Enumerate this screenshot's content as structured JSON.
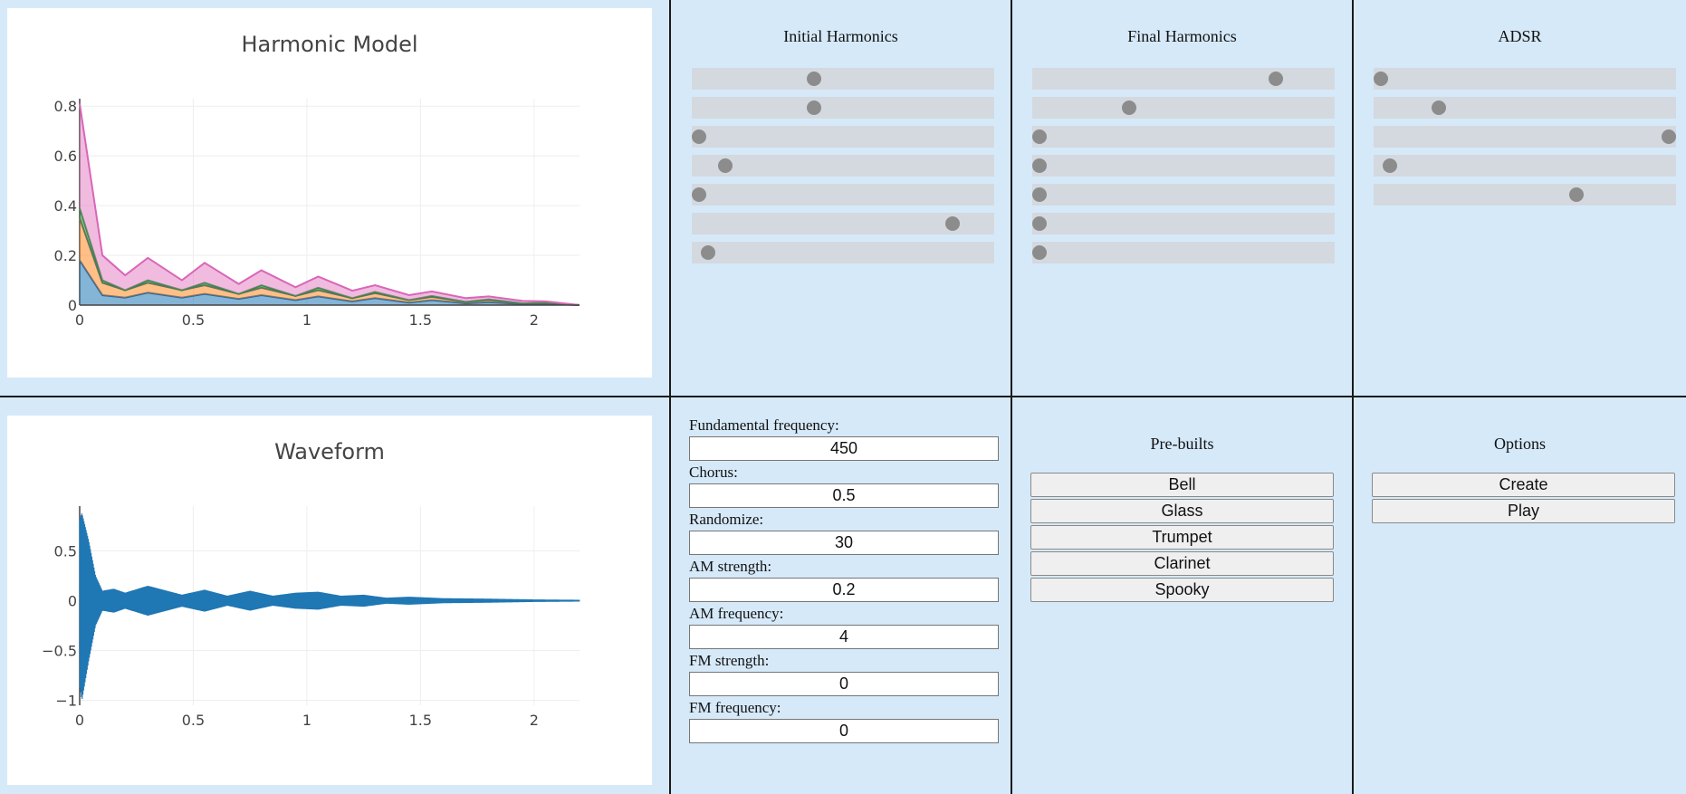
{
  "harmonic_plot": {
    "title": "Harmonic Model",
    "chart_data": {
      "type": "area",
      "x_range": [
        0,
        2.2
      ],
      "y_range": [
        0,
        0.83
      ],
      "x_ticks": [
        "0",
        "0.5",
        "1",
        "1.5",
        "2"
      ],
      "y_ticks": [
        "0",
        "0.2",
        "0.4",
        "0.6",
        "0.8"
      ],
      "x": [
        0,
        0.1,
        0.2,
        0.3,
        0.45,
        0.55,
        0.7,
        0.8,
        0.95,
        1.05,
        1.2,
        1.3,
        1.45,
        1.55,
        1.7,
        1.8,
        1.95,
        2.05,
        2.2
      ],
      "series": [
        {
          "values": [
            0.18,
            0.04,
            0.03,
            0.05,
            0.03,
            0.045,
            0.025,
            0.04,
            0.02,
            0.035,
            0.015,
            0.028,
            0.01,
            0.02,
            0.007,
            0.012,
            0.004,
            0.005,
            0.0
          ]
        },
        {
          "values": [
            0.17,
            0.05,
            0.03,
            0.04,
            0.03,
            0.035,
            0.02,
            0.03,
            0.017,
            0.025,
            0.013,
            0.02,
            0.01,
            0.013,
            0.006,
            0.009,
            0.003,
            0.004,
            0.0
          ]
        },
        {
          "values": [
            0.04,
            0.01,
            0.0,
            0.01,
            0.0,
            0.01,
            0.0,
            0.01,
            0.0,
            0.01,
            0.0,
            0.005,
            0.0,
            0.004,
            0.0,
            0.002,
            0.0,
            0.001,
            0.0
          ]
        },
        {
          "values": [
            0.42,
            0.1,
            0.06,
            0.09,
            0.04,
            0.08,
            0.04,
            0.06,
            0.035,
            0.045,
            0.03,
            0.027,
            0.02,
            0.018,
            0.015,
            0.012,
            0.01,
            0.005,
            0.0
          ]
        }
      ]
    }
  },
  "waveform_plot": {
    "title": "Waveform",
    "chart_data": {
      "type": "line",
      "x_range": [
        0,
        2.2
      ],
      "y_range": [
        -1.05,
        0.95
      ],
      "x_ticks": [
        "0",
        "0.5",
        "1",
        "1.5",
        "2"
      ],
      "y_ticks": [
        "0.5",
        "0",
        "−0.5",
        "−1"
      ],
      "y_tick_values": [
        0.5,
        0,
        -0.5,
        -1
      ],
      "envelope_x": [
        0,
        0.01,
        0.04,
        0.07,
        0.1,
        0.15,
        0.2,
        0.3,
        0.35,
        0.45,
        0.55,
        0.65,
        0.75,
        0.85,
        0.95,
        1.05,
        1.15,
        1.25,
        1.35,
        1.45,
        1.6,
        1.8,
        2.0,
        2.2
      ],
      "envelope_top": [
        0.82,
        0.88,
        0.6,
        0.25,
        0.1,
        0.12,
        0.08,
        0.15,
        0.12,
        0.06,
        0.11,
        0.05,
        0.1,
        0.05,
        0.08,
        0.09,
        0.05,
        0.06,
        0.03,
        0.04,
        0.025,
        0.02,
        0.012,
        0.008
      ],
      "envelope_bottom": [
        -0.85,
        -1.0,
        -0.6,
        -0.25,
        -0.1,
        -0.12,
        -0.08,
        -0.15,
        -0.12,
        -0.06,
        -0.11,
        -0.05,
        -0.1,
        -0.05,
        -0.08,
        -0.09,
        -0.05,
        -0.06,
        -0.03,
        -0.04,
        -0.025,
        -0.02,
        -0.012,
        -0.008
      ]
    }
  },
  "initial_harmonics": {
    "title": "Initial Harmonics",
    "sliders": [
      0.4,
      0.4,
      0.0,
      0.09,
      0.0,
      0.88,
      0.03
    ]
  },
  "final_harmonics": {
    "title": "Final Harmonics",
    "sliders": [
      0.82,
      0.31,
      0.0,
      0.0,
      0.0,
      0.0,
      0.0
    ]
  },
  "adsr": {
    "title": "ADSR",
    "sliders": [
      0.0,
      0.2,
      1.0,
      0.03,
      0.68
    ]
  },
  "parameters": {
    "fields": [
      {
        "label": "Fundamental frequency:",
        "value": "450"
      },
      {
        "label": "Chorus:",
        "value": "0.5"
      },
      {
        "label": "Randomize:",
        "value": "30"
      },
      {
        "label": "AM strength:",
        "value": "0.2"
      },
      {
        "label": "AM frequency:",
        "value": "4"
      },
      {
        "label": "FM strength:",
        "value": "0"
      },
      {
        "label": "FM frequency:",
        "value": "0"
      }
    ]
  },
  "prebuilts": {
    "title": "Pre-builts",
    "buttons": [
      "Bell",
      "Glass",
      "Trumpet",
      "Clarinet",
      "Spooky"
    ]
  },
  "options": {
    "title": "Options",
    "buttons": [
      "Create",
      "Play"
    ]
  },
  "colors": {
    "background": "#d6e9f9",
    "slider_track": "#d4d9df",
    "slider_knob": "#8c8c8c",
    "plotly_blue": "#1f77b4",
    "plotly_orange": "#ff7f0e",
    "plotly_green": "#2ca02c",
    "plotly_pink": "#e377c2"
  }
}
